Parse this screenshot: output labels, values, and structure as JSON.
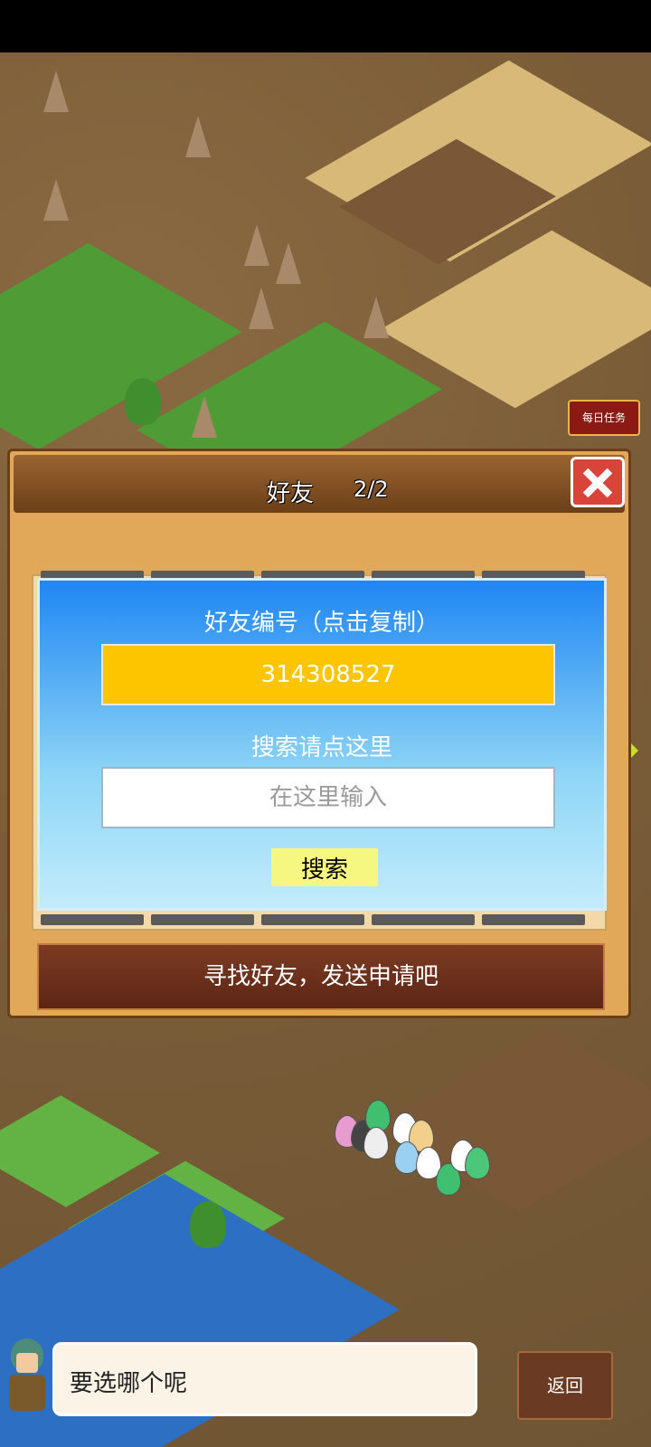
{
  "hud": {
    "daily_task_label": "每日任务"
  },
  "dialog": {
    "title": "好友",
    "count": "2/2",
    "close_icon": "close-x-icon"
  },
  "friend_panel": {
    "id_label": "好友编号（点击复制）",
    "friend_id": "314308527",
    "search_label": "搜索请点这里",
    "search_placeholder": "在这里输入",
    "search_button": "搜索"
  },
  "banner": {
    "text": "寻找好友，发送申请吧"
  },
  "bottom": {
    "speech_text": "要选哪个呢",
    "back_label": "返回"
  },
  "colors": {
    "panel_blue": "#1f86f2",
    "id_box_yellow": "#fdc400",
    "search_button_yellow": "#f6f781",
    "arrow_green": "#c9df28",
    "close_red": "#d8443a"
  }
}
